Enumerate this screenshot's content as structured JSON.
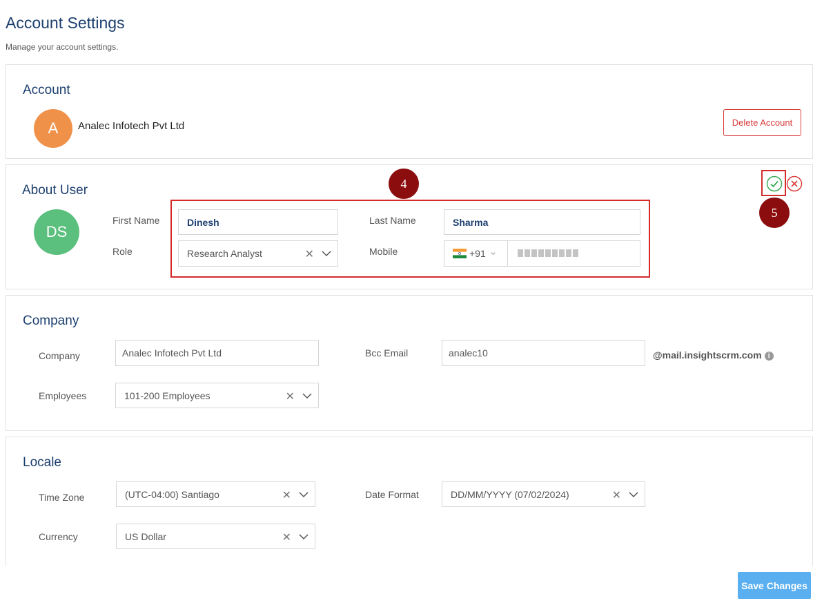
{
  "header": {
    "title": "Account Settings",
    "subtitle": "Manage your account settings."
  },
  "account": {
    "title": "Account",
    "avatar_initial": "A",
    "avatar_color": "#f0914a",
    "company_name": "Analec Infotech Pvt Ltd",
    "delete_label": "Delete Account"
  },
  "about": {
    "title": "About User",
    "avatar_initials": "DS",
    "avatar_color": "#5bbf7d",
    "first_name_label": "First Name",
    "first_name_value": "Dinesh",
    "last_name_label": "Last Name",
    "last_name_value": "Sharma",
    "role_label": "Role",
    "role_value": "Research Analyst",
    "mobile_label": "Mobile",
    "mobile_country_code": "+91"
  },
  "annotations": {
    "marker_4": "4",
    "marker_5": "5"
  },
  "company": {
    "title": "Company",
    "company_label": "Company",
    "company_value": "Analec Infotech Pvt Ltd",
    "bcc_label": "Bcc Email",
    "bcc_value": "analec10",
    "bcc_suffix": "@mail.insightscrm.com",
    "employees_label": "Employees",
    "employees_value": "101-200 Employees"
  },
  "locale": {
    "title": "Locale",
    "timezone_label": "Time Zone",
    "timezone_value": "(UTC-04:00) Santiago",
    "date_format_label": "Date Format",
    "date_format_value": "DD/MM/YYYY (07/02/2024)",
    "currency_label": "Currency",
    "currency_value": "US Dollar"
  },
  "footer": {
    "save_label": "Save Changes"
  }
}
